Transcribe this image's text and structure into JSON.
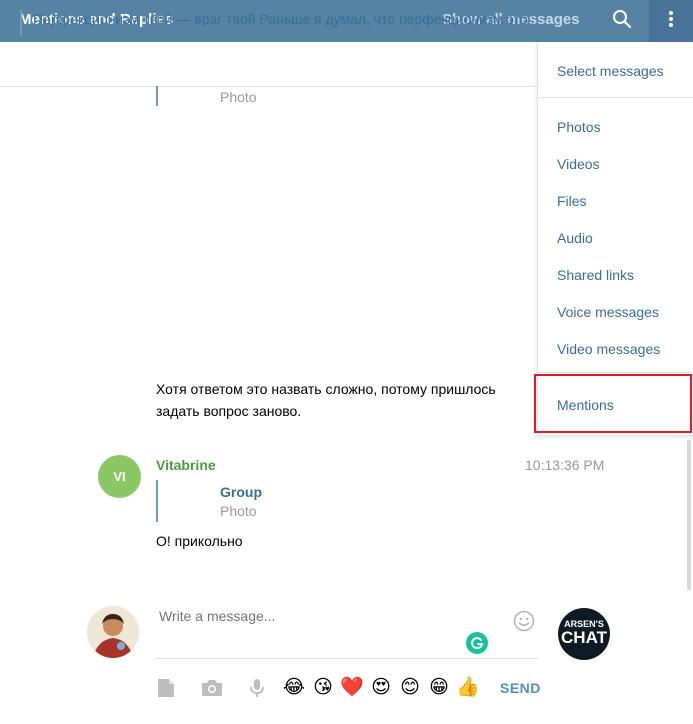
{
  "header": {
    "title": "Mentions and Replies",
    "show_all_label": "Show all messages",
    "search_icon": "search-icon",
    "more_icon": "vertical-ellipsis-icon"
  },
  "pinned": {
    "text": "Перфекционизм твой — враг твой Раньше я думал, что перфекционизм это хо"
  },
  "messages": [
    {
      "reply_media_label": "Photo",
      "text": "Хотя ответом это назвать сложно, потому пришлось задать вопрос заново."
    },
    {
      "avatar_initials": "VI",
      "author": "Vitabrine",
      "time": "10:13:36 PM",
      "reply_title": "Group",
      "reply_media_label": "Photo",
      "text": "О! прикольно"
    }
  ],
  "compose": {
    "placeholder": "Write a message...",
    "send_label": "SEND",
    "chat_logo_line1": "ARSEN'S",
    "chat_logo_line2": "CHAT",
    "emojis": [
      "😂",
      "😘",
      "❤️",
      "😍",
      "😊",
      "😁",
      "👍"
    ]
  },
  "menu": {
    "items": [
      "Select messages",
      "Photos",
      "Videos",
      "Files",
      "Audio",
      "Shared links",
      "Voice messages",
      "Video messages",
      "Mentions"
    ],
    "highlight_color": "#e01b22"
  },
  "colors": {
    "header_bg": "#5682a3",
    "link": "#3a6d99",
    "author_green": "#4a9d3d",
    "avatar_green": "#8bc865"
  }
}
